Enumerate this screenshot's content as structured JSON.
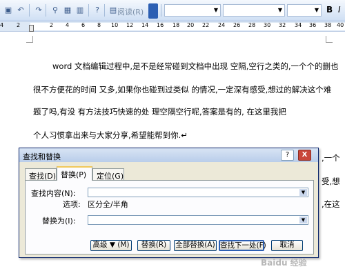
{
  "toolbar": {
    "read_label": "阅读(R)",
    "bold_label": "B",
    "italic_label": "I"
  },
  "ruler": {
    "ticks": [
      "4",
      "2",
      "2",
      "4",
      "6",
      "8",
      "10",
      "12",
      "14",
      "16",
      "18",
      "20",
      "22",
      "24",
      "26",
      "28",
      "30",
      "32",
      "34",
      "36",
      "38",
      "40"
    ]
  },
  "document": {
    "lines": [
      "word 文档编辑过程中,是不是经常碰到文档中出现    空隔,空行之类的,一个个的删也",
      "很不方便花的时间     又多,如果你也碰到过类似    的情况,一定深有感受,想过的解决这个难",
      "题了吗,有没      有方法技巧快速的处         理空隔空行呢,答案是有的,             在这里我把",
      "个人习惯拿出来与大家分享,希望能帮到你.↵"
    ],
    "overflow_right": [
      ",一个",
      "受,想",
      ",在这"
    ]
  },
  "dialog": {
    "title": "查找和替换",
    "help_btn": "?",
    "close_btn": "X",
    "tabs": [
      "查找(D)",
      "替换(P)",
      "定位(G)"
    ],
    "find_label": "查找内容(N):",
    "options_label": "选项:",
    "options_value": "区分全/半角",
    "replace_label": "替换为(I):",
    "find_value": "",
    "replace_value": "",
    "buttons": {
      "more": "高级 ▼ (M)",
      "replace": "替换(R)",
      "replace_all": "全部替换(A)",
      "find_next": "查找下一处(F)",
      "cancel": "取消"
    }
  },
  "watermark": "Baidu 经验"
}
